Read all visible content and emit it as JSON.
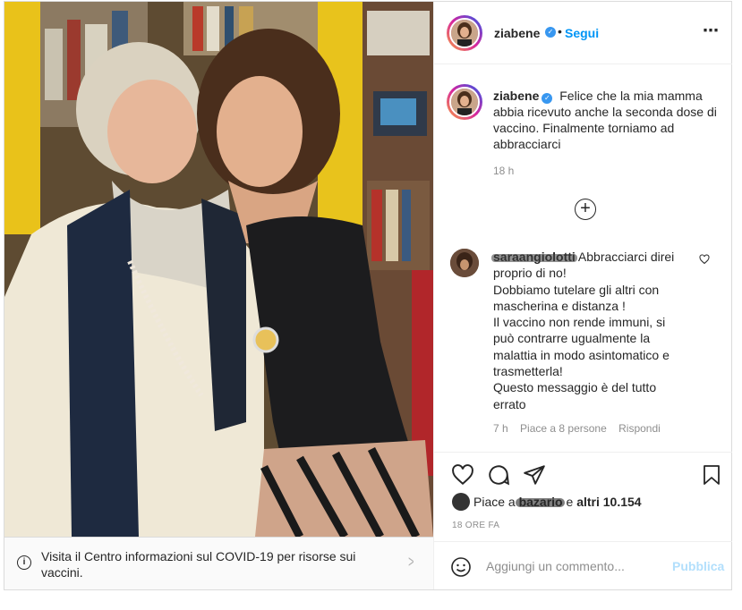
{
  "post": {
    "author": "ziabene",
    "follow_label": "Segui",
    "more_icon": "⋯",
    "caption": "Felice che la mia mamma abbia ricevuto anche la seconda dose di vaccino. Finalmente torniamo ad abbracciarci",
    "caption_time": "18 h",
    "date": "18 ORE FA"
  },
  "comment": {
    "user": "saraangiolotti",
    "text": "Abbracciarci direi proprio di no!\nDobbiamo tutelare gli altri con mascherina e distanza !\nIl vaccino non rende immuni, si può contrarre ugualmente la malattia in modo asintomatico e trasmetterla!\nQuesto messaggio è del tutto errato",
    "time": "7 h",
    "likes": "Piace a 8 persone",
    "reply": "Rispondi"
  },
  "likes": {
    "prefix": "Piace a",
    "user": "bazario",
    "suffix": "e",
    "others": "altri 10.154"
  },
  "covid": {
    "text": "Visita il Centro informazioni sul COVID-19 per risorse sui vaccini."
  },
  "add_comment": {
    "placeholder": "Aggiungi un commento...",
    "publish": "Pubblica"
  },
  "colors": {
    "accent": "#0095f6",
    "verified": "#3897f0",
    "muted": "#8e8e8e",
    "publish_disabled": "#b2dffc"
  }
}
